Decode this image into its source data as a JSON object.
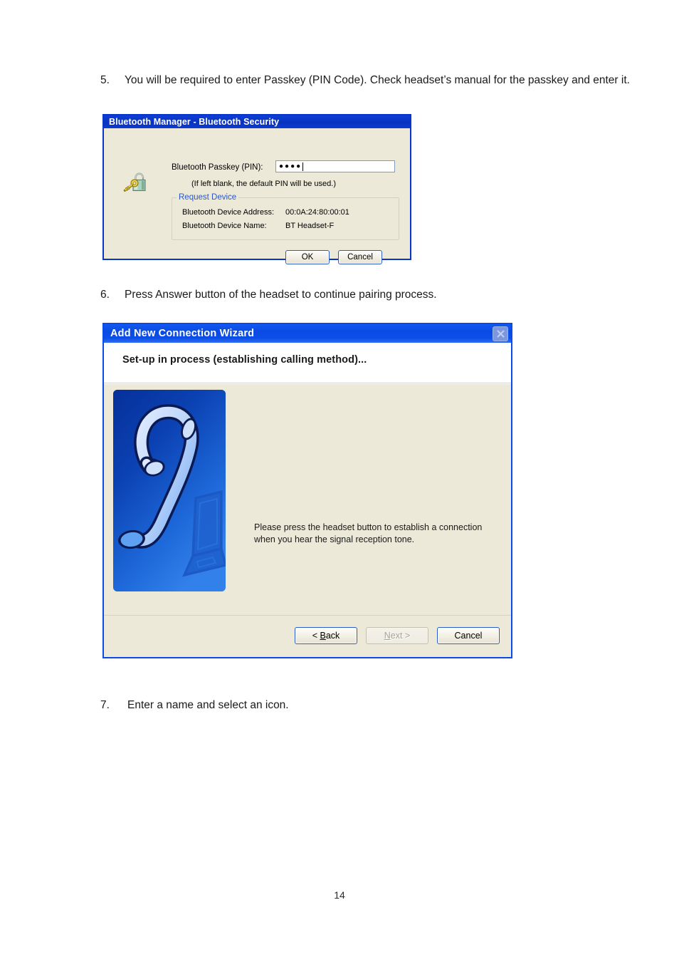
{
  "document": {
    "steps": [
      {
        "number": "5.",
        "text": "You will be required to enter Passkey (PIN Code). Check headset’s manual for the passkey and enter it."
      },
      {
        "number": "6.",
        "text": "Press Answer button of the headset to continue pairing process."
      },
      {
        "number": "7.",
        "text": "Enter a name and select an icon."
      }
    ],
    "page_number": "14"
  },
  "security_dialog": {
    "title": "Bluetooth Manager  -  Bluetooth Security",
    "icon": "key-padlock-icon",
    "passkey_label": "Bluetooth Passkey (PIN):",
    "passkey_value": "●●●●",
    "passkey_placeholder": "",
    "hint": "(If left blank, the default PIN will be used.)",
    "group": {
      "legend": "Request Device",
      "legend_color": "#2a57c8",
      "rows": [
        {
          "label": "Bluetooth Device Address:",
          "value": "00:0A:24:80:00:01"
        },
        {
          "label": "Bluetooth Device Name:",
          "value": "BT Headset-F"
        }
      ]
    },
    "buttons": {
      "ok": "OK",
      "cancel": "Cancel"
    },
    "colors": {
      "titlebar": "#0a32bf",
      "face": "#ece9d8",
      "border": "#0a35c8"
    }
  },
  "wizard_dialog": {
    "title": "Add New Connection Wizard",
    "close_icon": "close-icon",
    "header": "Set-up in process (establishing calling method)...",
    "illustration": "bluetooth-headset-laptop-illustration",
    "instruction": "Please press the headset button to establish a connection when you hear the signal reception tone.",
    "buttons": {
      "back": {
        "prefix": "< ",
        "accel": "B",
        "rest": "ack",
        "state": "default"
      },
      "next": {
        "accel": "N",
        "rest": "ext",
        "suffix": " >",
        "state": "disabled"
      },
      "cancel": {
        "label": "Cancel",
        "state": "normal"
      }
    },
    "colors": {
      "titlebar": "#0b4ae4",
      "face": "#ece9d8",
      "header_bg": "#ffffff",
      "border": "#0a4ae8"
    }
  }
}
